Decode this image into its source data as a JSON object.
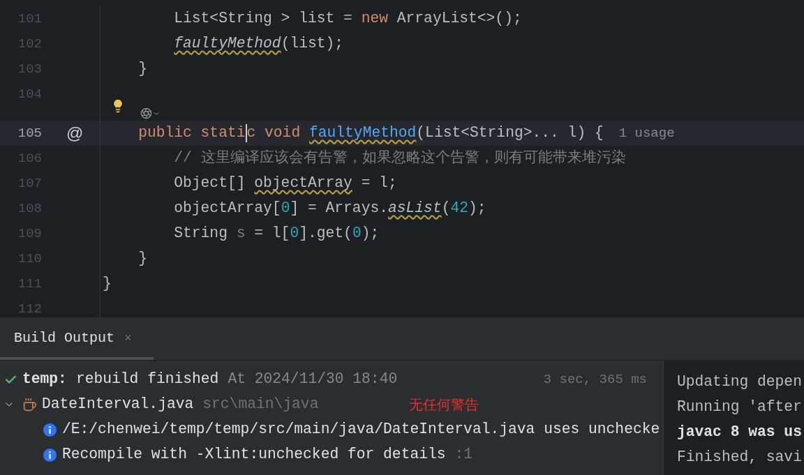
{
  "editor": {
    "lines": [
      {
        "number": "101",
        "current": false,
        "intention_bulb": false,
        "tokens": [
          {
            "text": "        List<String > list = ",
            "kind": "plain"
          },
          {
            "text": "new",
            "kind": "keyword"
          },
          {
            "text": " ArrayList<>();",
            "kind": "plain"
          }
        ]
      },
      {
        "number": "102",
        "current": false,
        "intention_bulb": false,
        "tokens": [
          {
            "text": "        faultyMethod",
            "kind": "warn_italic"
          },
          {
            "text": "(list);",
            "kind": "plain"
          }
        ]
      },
      {
        "number": "103",
        "current": false,
        "intention_bulb": false,
        "tokens": [
          {
            "text": "    }",
            "kind": "plain"
          }
        ]
      },
      {
        "number": "104",
        "current": false,
        "intention_bulb": true
      },
      {
        "number": "105",
        "current": true,
        "intention_bulb": false,
        "gutter_mark": "@",
        "tokens": [
          {
            "text": "    public stati",
            "kind": "keyword"
          },
          {
            "text": "c void",
            "kind": "keyword",
            "caret_before": true
          },
          {
            "text": " faultyMethod",
            "kind": "decl_warn"
          },
          {
            "text": "(List<String>... l) {",
            "kind": "plain"
          },
          {
            "text": "1 usage",
            "kind": "hint"
          }
        ]
      },
      {
        "number": "106",
        "current": false,
        "intention_bulb": false,
        "tokens": [
          {
            "text": "        // 这里编译应该会有告警，如果忽略这个告警，则有可能带来堆污染",
            "kind": "comment"
          }
        ]
      },
      {
        "number": "107",
        "current": false,
        "intention_bulb": false,
        "tokens": [
          {
            "text": "        Object[] ",
            "kind": "plain"
          },
          {
            "text": "objectArray",
            "kind": "warn"
          },
          {
            "text": " = l;",
            "kind": "plain"
          }
        ]
      },
      {
        "number": "108",
        "current": false,
        "intention_bulb": false,
        "tokens": [
          {
            "text": "        objectArray[",
            "kind": "plain"
          },
          {
            "text": "0",
            "kind": "number"
          },
          {
            "text": "] = Arrays.",
            "kind": "plain"
          },
          {
            "text": "asList",
            "kind": "warn_italic"
          },
          {
            "text": "(",
            "kind": "plain"
          },
          {
            "text": "42",
            "kind": "number"
          },
          {
            "text": ");",
            "kind": "plain"
          }
        ]
      },
      {
        "number": "109",
        "current": false,
        "intention_bulb": false,
        "tokens": [
          {
            "text": "        String ",
            "kind": "plain"
          },
          {
            "text": "s",
            "kind": "unused"
          },
          {
            "text": " = l[",
            "kind": "plain"
          },
          {
            "text": "0",
            "kind": "number"
          },
          {
            "text": "].get(",
            "kind": "plain"
          },
          {
            "text": "0",
            "kind": "number"
          },
          {
            "text": ");",
            "kind": "plain"
          }
        ]
      },
      {
        "number": "110",
        "current": false,
        "intention_bulb": false,
        "tokens": [
          {
            "text": "    }",
            "kind": "plain"
          }
        ]
      },
      {
        "number": "111",
        "current": false,
        "intention_bulb": false,
        "tokens": [
          {
            "text": "}",
            "kind": "plain"
          }
        ]
      },
      {
        "number": "112",
        "current": false,
        "intention_bulb": false
      }
    ]
  },
  "build_panel": {
    "tabs": [
      {
        "label": "Build Output",
        "selected": true,
        "close": "×"
      }
    ],
    "tree": [
      {
        "kind": "result",
        "title": "temp:",
        "text": "rebuild finished",
        "time": "At 2024/11/30 18:40",
        "duration": "3 sec, 365 ms"
      },
      {
        "kind": "file",
        "expanded": true,
        "text": "DateInterval.java",
        "path": "src\\main\\java",
        "annotation": "无任何警告"
      },
      {
        "kind": "info",
        "text": "/E:/chenwei/temp/temp/src/main/java/DateInterval.java uses unchecke"
      },
      {
        "kind": "info",
        "text": "Recompile with -Xlint:unchecked for details",
        "suffix": ":1"
      }
    ],
    "console": [
      {
        "text": "Updating depen",
        "bold": false
      },
      {
        "text": "Running 'after",
        "bold": false
      },
      {
        "text": "javac 8 was us",
        "bold": true
      },
      {
        "text": "Finished, savi",
        "bold": false
      }
    ]
  }
}
